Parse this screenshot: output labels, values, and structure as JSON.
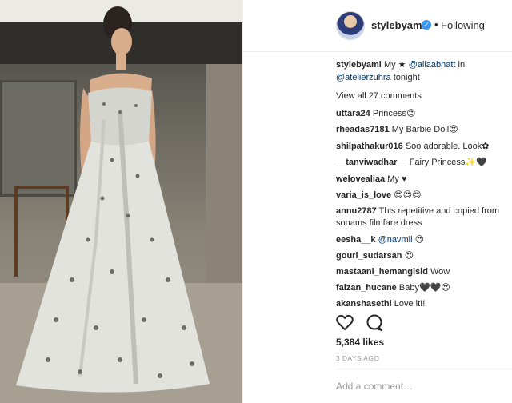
{
  "header": {
    "username": "stylebyami",
    "separator": "•",
    "follow_status": "Following"
  },
  "caption": {
    "username": "stylebyami",
    "text_before": "My",
    "star_glyph": "★",
    "mention1": "@aliaabhatt",
    "text_mid": "in",
    "mention2": "@atelierzuhra",
    "text_after": "tonight"
  },
  "view_all": "View all 27 comments",
  "comments": [
    {
      "user": "uttara24",
      "text": "Princess😍"
    },
    {
      "user": "rheadas7181",
      "text": "My Barbie Doll😍"
    },
    {
      "user": "shilpathakur016",
      "text": "Soo adorable. Look✿"
    },
    {
      "user": "__tanviwadhar__",
      "text": "Fairy Princess✨🖤"
    },
    {
      "user": "welovealiaa",
      "text": "My ♥"
    },
    {
      "user": "varia_is_love",
      "text": "😍😍😍"
    },
    {
      "user": "annu2787",
      "text": "This repetitive and copied from",
      "text2": "sonams filmfare dress"
    },
    {
      "user": "eesha__k",
      "mention": "@navmii",
      "text": "😍"
    },
    {
      "user": "gouri_sudarsan",
      "text": "😍"
    },
    {
      "user": "mastaani_hemangisid",
      "text": "Wow"
    },
    {
      "user": "faizan_hucane",
      "text": "Baby🖤🖤😍"
    },
    {
      "user": "akanshasethi",
      "text": "Love it!!"
    }
  ],
  "likes": "5,384 likes",
  "date": "3 DAYS AGO",
  "add_comment_placeholder": "Add a comment…",
  "icons": {
    "like": "heart-icon",
    "comment": "comment-icon",
    "verified": "verified-badge-icon"
  },
  "colors": {
    "verified": "#3897f0",
    "mention": "#003569",
    "muted": "#999999"
  }
}
